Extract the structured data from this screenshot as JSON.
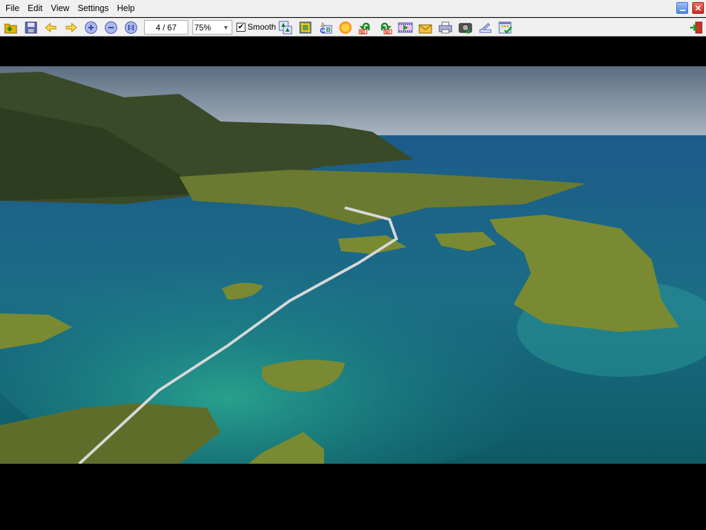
{
  "menu": {
    "items": [
      "File",
      "Edit",
      "View",
      "Settings",
      "Help"
    ]
  },
  "window": {
    "minimize_icon": "minimize-icon",
    "close_icon": "close-icon"
  },
  "toolbar": {
    "page_indicator": "4 / 67",
    "zoom_value": "75%",
    "smooth_label": "Smooth",
    "smooth_checked": true,
    "buttons": [
      "open-folder-icon",
      "save-icon",
      "previous-icon",
      "next-icon",
      "zoom-in-icon",
      "zoom-out-icon",
      "original-size-icon",
      "thumbnails-icon",
      "crop-icon",
      "rename-icon",
      "color-correction-icon",
      "rotate-left-icon",
      "rotate-right-icon",
      "slideshow-icon",
      "email-icon",
      "print-icon",
      "capture-icon",
      "scan-icon",
      "properties-icon",
      "exit-icon"
    ]
  },
  "image": {
    "description_icon": "landscape-photo"
  },
  "colors": {
    "accent": "#3a6fd8",
    "close": "#d9382a"
  }
}
